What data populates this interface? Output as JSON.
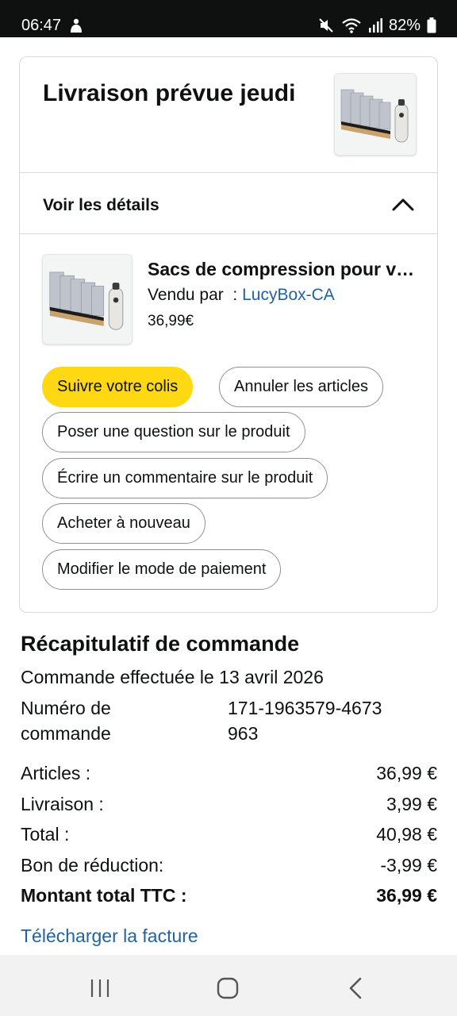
{
  "status_bar": {
    "time": "06:47",
    "battery": "82%"
  },
  "delivery": {
    "title": "Livraison prévue jeudi",
    "details_label": "Voir les détails"
  },
  "product": {
    "name": "Sacs de compression pour voyage",
    "seller_prefix": "Vendu par  : ",
    "seller": "LucyBox-CA",
    "price": "36,99€"
  },
  "actions": {
    "track": "Suivre votre colis",
    "cancel": "Annuler les articles",
    "question": "Poser une question sur le produit",
    "review": "Écrire un commentaire sur le produit",
    "buy_again": "Acheter à nouveau",
    "payment": "Modifier le mode de paiement"
  },
  "summary": {
    "title": "Récapitulatif de commande",
    "order_date": "Commande effectuée le 13 avril 2026",
    "order_number_label": "Numéro de commande",
    "order_number": "171-1963579-4673963",
    "lines": [
      {
        "label": "Articles :",
        "value": "36,99 €"
      },
      {
        "label": "Livraison :",
        "value": "3,99 €"
      },
      {
        "label": "Total :",
        "value": "40,98 €"
      },
      {
        "label": "Bon de réduction:",
        "value": "-3,99 €"
      },
      {
        "label": "Montant total TTC :",
        "value": "36,99 €"
      }
    ],
    "invoice_link": "Télécharger la facture"
  },
  "icons": {
    "status_person": "person-icon",
    "mute": "mute-icon",
    "wifi": "wifi-icon",
    "signal": "signal-icon",
    "battery": "battery-icon",
    "chevron": "chevron-up-icon",
    "nav_recents": "recent-apps-icon",
    "nav_home": "home-icon",
    "nav_back": "back-icon"
  },
  "colors": {
    "primary_button": "#ffd814",
    "link": "#2162a1",
    "status_bar": "#0f1111"
  }
}
